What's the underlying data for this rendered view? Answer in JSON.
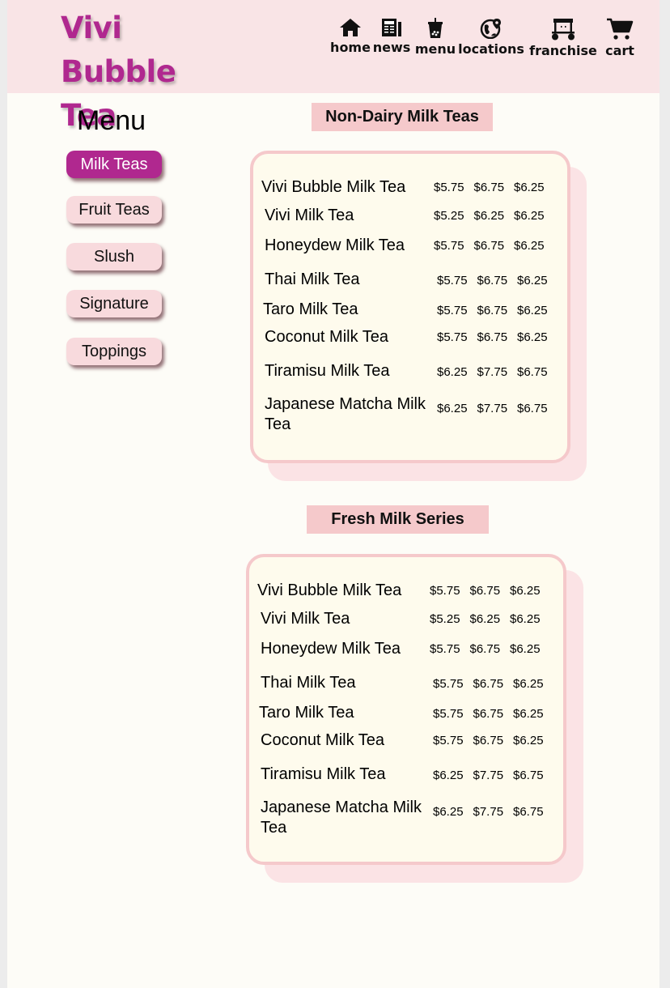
{
  "brand": {
    "name_line1": "Vivi Bubble",
    "name_line2": "Tea"
  },
  "nav": [
    {
      "label": "home",
      "icon": "home-icon"
    },
    {
      "label": "news",
      "icon": "newspaper-icon"
    },
    {
      "label": "menu",
      "icon": "bubble-tea-cup-icon"
    },
    {
      "label": "locations",
      "icon": "globe-pin-icon"
    },
    {
      "label": "franchise",
      "icon": "shop-cart-icon"
    },
    {
      "label": "cart",
      "icon": "shopping-cart-icon"
    }
  ],
  "sidebar": {
    "title": "Menu",
    "categories": [
      {
        "label": "Milk Teas",
        "active": true
      },
      {
        "label": "Fruit Teas",
        "active": false
      },
      {
        "label": "Slush",
        "active": false
      },
      {
        "label": "Signature",
        "active": false
      },
      {
        "label": "Toppings",
        "active": false
      }
    ]
  },
  "sections": [
    {
      "title": "Non-Dairy Milk Teas",
      "items": [
        {
          "name": "Vivi Bubble Milk Tea",
          "prices": [
            "$5.75",
            "$6.75",
            "$6.25"
          ]
        },
        {
          "name": "Vivi Milk Tea",
          "prices": [
            "$5.25",
            "$6.25",
            "$6.25"
          ]
        },
        {
          "name": "Honeydew Milk Tea",
          "prices": [
            "$5.75",
            "$6.75",
            "$6.25"
          ]
        },
        {
          "name": "Thai Milk Tea",
          "prices": [
            "$5.75",
            "$6.75",
            "$6.25"
          ]
        },
        {
          "name": "Taro Milk Tea",
          "prices": [
            "$5.75",
            "$6.75",
            "$6.25"
          ]
        },
        {
          "name": "Coconut Milk Tea",
          "prices": [
            "$5.75",
            "$6.75",
            "$6.25"
          ]
        },
        {
          "name": "Tiramisu Milk Tea",
          "prices": [
            "$6.25",
            "$7.75",
            "$6.75"
          ]
        },
        {
          "name": "Japanese Matcha Milk Tea",
          "prices": [
            "$6.25",
            "$7.75",
            "$6.75"
          ]
        }
      ]
    },
    {
      "title": "Fresh Milk Series",
      "items": [
        {
          "name": "Vivi Bubble Milk Tea",
          "prices": [
            "$5.75",
            "$6.75",
            "$6.25"
          ]
        },
        {
          "name": "Vivi Milk Tea",
          "prices": [
            "$5.25",
            "$6.25",
            "$6.25"
          ]
        },
        {
          "name": "Honeydew Milk Tea",
          "prices": [
            "$5.75",
            "$6.75",
            "$6.25"
          ]
        },
        {
          "name": "Thai Milk Tea",
          "prices": [
            "$5.75",
            "$6.75",
            "$6.25"
          ]
        },
        {
          "name": "Taro Milk Tea",
          "prices": [
            "$5.75",
            "$6.75",
            "$6.25"
          ]
        },
        {
          "name": "Coconut Milk Tea",
          "prices": [
            "$5.75",
            "$6.75",
            "$6.25"
          ]
        },
        {
          "name": "Tiramisu Milk Tea",
          "prices": [
            "$6.25",
            "$7.75",
            "$6.75"
          ]
        },
        {
          "name": "Japanese Matcha Milk Tea",
          "prices": [
            "$6.25",
            "$7.75",
            "$6.75"
          ]
        }
      ]
    }
  ],
  "colors": {
    "brand": "#b0288f",
    "header_bg": "#f9e4e6",
    "section_title_bg": "#f5c9cb",
    "card_border": "#f5c9cb",
    "card_bg": "#fefbed"
  }
}
